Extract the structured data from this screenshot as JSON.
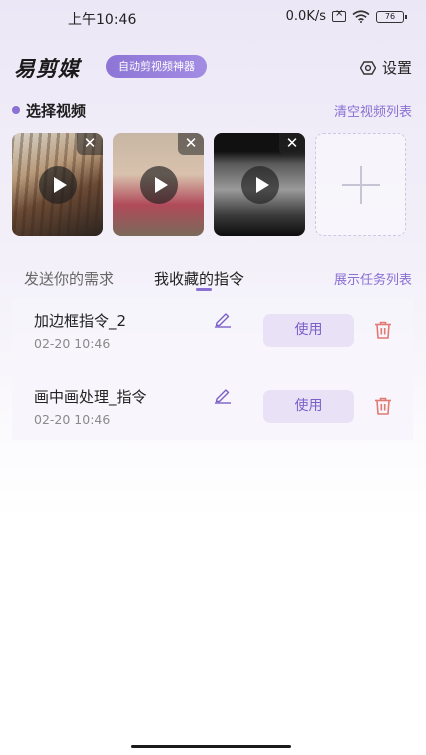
{
  "status_bar": {
    "time": "上午10:46",
    "speed": "0.0K/s",
    "battery": "76"
  },
  "header": {
    "logo": "易剪媒",
    "badge": "自动剪视频神器",
    "settings_label": "设置"
  },
  "select_section": {
    "title": "选择视频",
    "clear_label": "清空视频列表",
    "close_glyph": "✕"
  },
  "tabs": {
    "send": "发送你的需求",
    "favorites": "我收藏的指令",
    "show_tasks": "展示任务列表"
  },
  "commands": [
    {
      "name": "加边框指令_2",
      "time": "02-20 10:46",
      "use_label": "使用"
    },
    {
      "name": "画中画处理_指令",
      "time": "02-20 10:46",
      "use_label": "使用"
    }
  ],
  "colors": {
    "accent": "#8a6fd4",
    "use_button_bg": "#e9e2f6",
    "delete_red": "#e07a72"
  }
}
